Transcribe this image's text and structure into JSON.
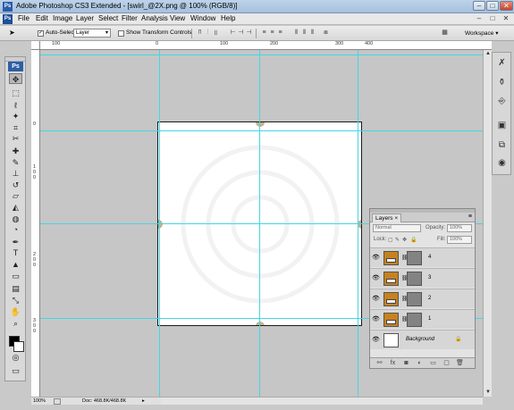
{
  "window": {
    "title": "Adobe Photoshop CS3 Extended - [swirl_@2X.png @ 100% (RGB/8)]",
    "app_icon": "Ps",
    "min_glyph": "–",
    "max_glyph": "□",
    "close_glyph": "✕"
  },
  "menubar": {
    "logo": "Ps",
    "items": [
      "File",
      "Edit",
      "Image",
      "Layer",
      "Select",
      "Filter",
      "Analysis",
      "View",
      "Window",
      "Help"
    ],
    "doc_min": "–",
    "doc_max": "□",
    "doc_close": "✕"
  },
  "options": {
    "tool_glyph": "➤",
    "auto_select_checked": true,
    "auto_select_label": "Auto-Select:",
    "auto_select_value": "Layer",
    "show_transform_checked": false,
    "show_transform_label": "Show Transform Controls",
    "workspace_label": "Workspace ▾"
  },
  "toolbox": {
    "badge": "Ps",
    "tools": [
      {
        "name": "move-tool",
        "glyph": "✥"
      },
      {
        "name": "marquee-tool",
        "glyph": "⬚"
      },
      {
        "name": "lasso-tool",
        "glyph": "ℓ"
      },
      {
        "name": "magic-wand-tool",
        "glyph": "✦"
      },
      {
        "name": "crop-tool",
        "glyph": "⌗"
      },
      {
        "name": "slice-tool",
        "glyph": "✂"
      },
      {
        "name": "healing-brush-tool",
        "glyph": "✚"
      },
      {
        "name": "brush-tool",
        "glyph": "✎"
      },
      {
        "name": "clone-stamp-tool",
        "glyph": "⊥"
      },
      {
        "name": "history-brush-tool",
        "glyph": "↺"
      },
      {
        "name": "eraser-tool",
        "glyph": "▱"
      },
      {
        "name": "paint-bucket-tool",
        "glyph": "◭"
      },
      {
        "name": "blur-tool",
        "glyph": "◍"
      },
      {
        "name": "dodge-tool",
        "glyph": "◔"
      },
      {
        "name": "pen-tool",
        "glyph": "✒"
      },
      {
        "name": "type-tool",
        "glyph": "T"
      },
      {
        "name": "path-selection-tool",
        "glyph": "▲"
      },
      {
        "name": "shape-tool",
        "glyph": "▭"
      },
      {
        "name": "notes-tool",
        "glyph": "▤"
      },
      {
        "name": "eyedropper-tool",
        "glyph": "⤡"
      },
      {
        "name": "hand-tool",
        "glyph": "✋"
      },
      {
        "name": "zoom-tool",
        "glyph": "⌕"
      }
    ]
  },
  "rulers": {
    "top_labels": [
      "100",
      "0",
      "100",
      "200",
      "300",
      "400"
    ],
    "left_labels": [
      "0",
      "1",
      "0",
      "0",
      "2",
      "0",
      "0",
      "3",
      "0",
      "0"
    ]
  },
  "status": {
    "zoom": "100%",
    "doc": "Doc: 468.8K/468.8K"
  },
  "right_dock": {
    "icons": [
      {
        "name": "tool-presets-icon",
        "glyph": "✗"
      },
      {
        "name": "brushes-icon",
        "glyph": "⚱"
      },
      {
        "name": "clone-source-icon",
        "glyph": "⎆"
      },
      {
        "name": "history-icon",
        "glyph": "▣"
      },
      {
        "name": "actions-icon",
        "glyph": "⧉"
      },
      {
        "name": "navigator-icon",
        "glyph": "◉"
      }
    ]
  },
  "layers": {
    "tab_label": "Layers ×",
    "blend_mode": "Normal",
    "opacity_label": "Opacity:",
    "opacity_value": "100%",
    "lock_label": "Lock:",
    "fill_label": "Fill:",
    "fill_value": "100%",
    "items": [
      {
        "name": "4",
        "thumb": "orange",
        "mask": true
      },
      {
        "name": "3",
        "thumb": "orange",
        "mask": true
      },
      {
        "name": "2",
        "thumb": "orange",
        "mask": true
      },
      {
        "name": "1",
        "thumb": "orange",
        "mask": true
      },
      {
        "name": "Background",
        "thumb": "white",
        "mask": false,
        "locked": true
      }
    ],
    "footer_icons": [
      "⚯",
      "fx",
      "◙",
      "◐",
      "▭",
      "▢",
      "🗑"
    ]
  }
}
